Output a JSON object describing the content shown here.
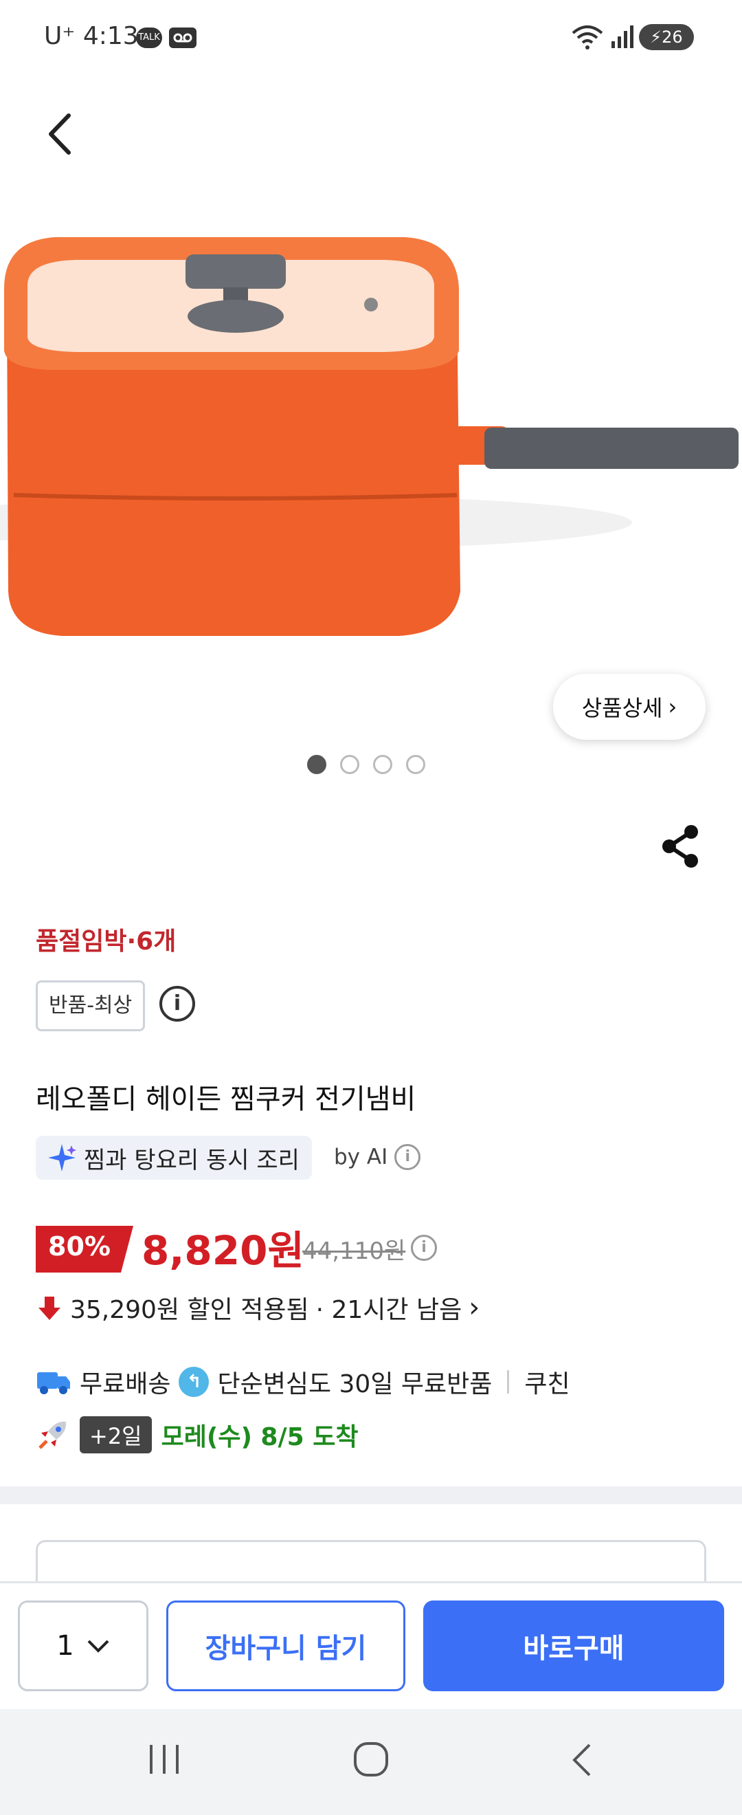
{
  "status_bar": {
    "carrier": "U⁺",
    "time": "4:13",
    "talk_icon": "TALK",
    "battery": "26"
  },
  "product": {
    "detail_button": "상품상세",
    "stock_notice": "품절임박·6개",
    "return_badge": "반품-최상",
    "title": "레오폴디 헤이든 찜쿠커 전기냄비",
    "ai_summary": "찜과 탕요리 동시 조리",
    "ai_by": "by AI",
    "discount_percent": "80%",
    "price": "8,820원",
    "original_price": "44,110원",
    "discount_applied": "35,290원 할인 적용됨",
    "time_left": "· 21시간 남음",
    "free_shipping": "무료배송",
    "free_return": "단순변심도 30일 무료반품",
    "seller": "쿠친",
    "arrival_badge": "+2일",
    "arrival_text": "모레(수) 8/5 도착",
    "image_pages": 4,
    "image_current": 1
  },
  "bottom_bar": {
    "quantity": "1",
    "cart_label": "장바구니 담기",
    "buy_label": "바로구매"
  },
  "colors": {
    "accent": "#3b6ff5",
    "price_red": "#d21f25",
    "arrival_green": "#1e8a1e",
    "product_orange": "#f0602a"
  }
}
